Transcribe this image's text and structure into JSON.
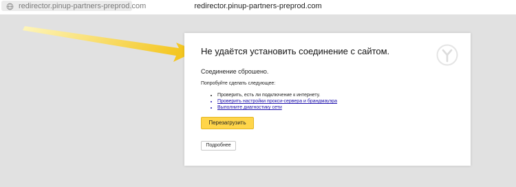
{
  "browser": {
    "address_left": "redirector.pinup-partners-preprod.com",
    "address_center": "redirector.pinup-partners-preprod.com"
  },
  "error_page": {
    "title": "Не удаётся установить соединение с сайтом.",
    "subtitle": "Соединение сброшено.",
    "try_text": "Попробуйте сделать следующее:",
    "steps": [
      "Проверить, есть ли подключение к интернету.",
      "Проверить настройки прокси-сервера и брандмауэра",
      "Выполните диагностику сети"
    ],
    "reload_label": "Перезагрузить",
    "details_label": "Подробнее"
  },
  "colors": {
    "background": "#e1e1e1",
    "accent_button": "#ffd54a",
    "link": "#1a0dab",
    "annotation_arrow": "#f6cc2e"
  },
  "icons": {
    "address": "globe-icon",
    "brand": "yandex-browser-logo-icon",
    "annotation": "arrow-pointer-icon"
  }
}
